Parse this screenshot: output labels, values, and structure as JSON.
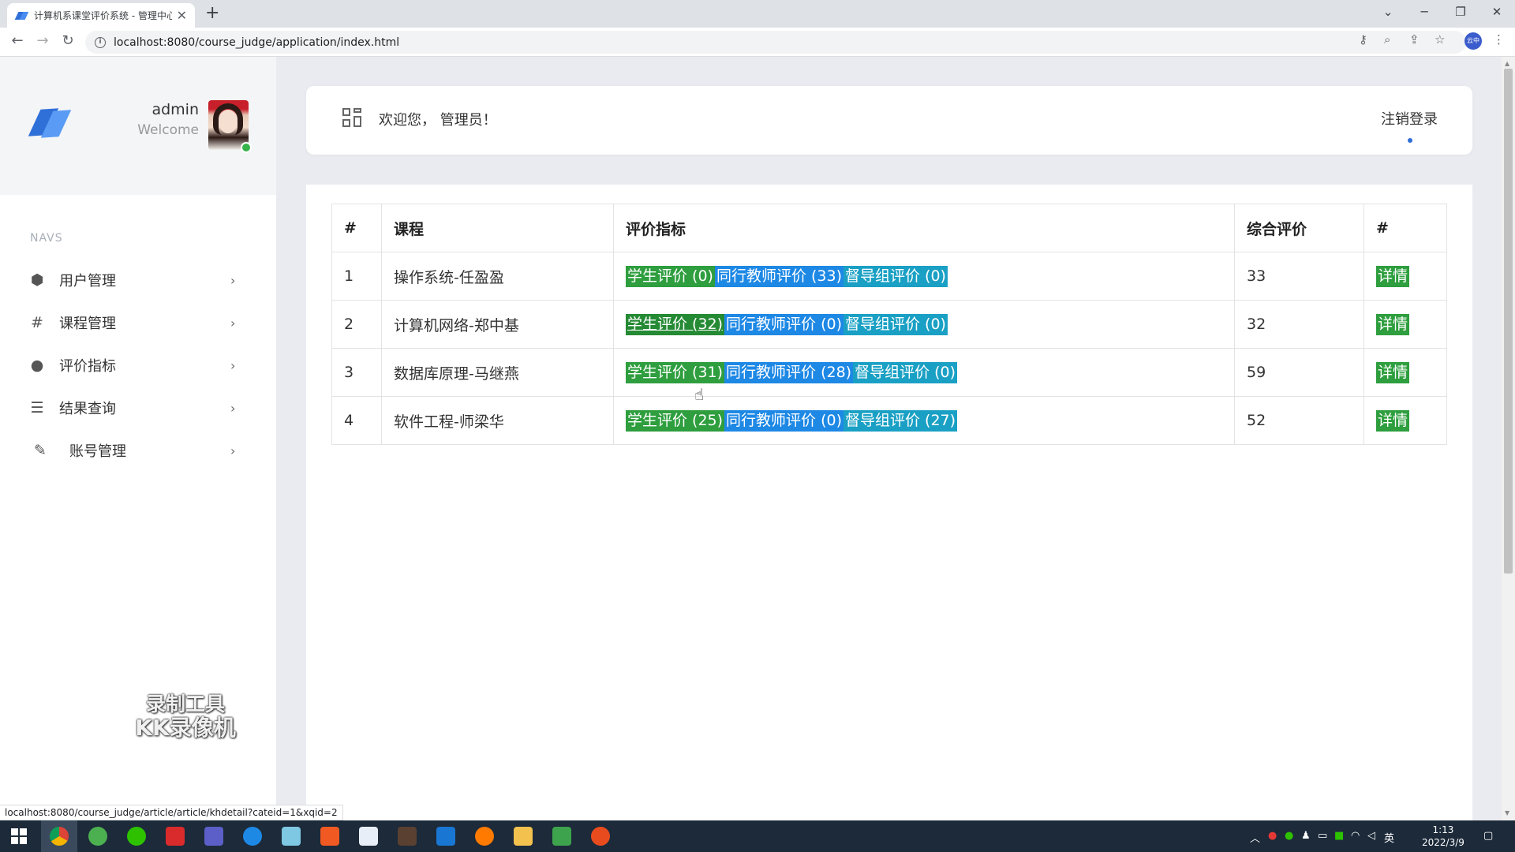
{
  "browser": {
    "tab_title": "计算机系课堂评价系统 - 管理中心",
    "tab_close": "✕",
    "new_tab": "+",
    "url": "localhost:8080/course_judge/application/index.html",
    "profile_label": "云中",
    "status_url": "localhost:8080/course_judge/article/article/khdetail?cateid=1&xqid=2"
  },
  "sidebar": {
    "username": "admin",
    "subtitle": "Welcome",
    "navs_label": "NAVS",
    "items": [
      {
        "label": "用户管理",
        "icon": "cube-icon",
        "glyph": "⬢"
      },
      {
        "label": "课程管理",
        "icon": "hash-icon",
        "glyph": "#"
      },
      {
        "label": "评价指标",
        "icon": "circle-icon",
        "glyph": "●"
      },
      {
        "label": "结果查询",
        "icon": "list-icon",
        "glyph": "☰"
      },
      {
        "label": "账号管理",
        "icon": "pencil-icon",
        "glyph": "✎"
      }
    ],
    "watermark_line1": "录制工具",
    "watermark_line2": "KK录像机"
  },
  "header": {
    "welcome": "欢迎您，  管理员！",
    "logout": "注销登录"
  },
  "table": {
    "headers": [
      "#",
      "课程",
      "评价指标",
      "综合评价",
      "#"
    ],
    "rows": [
      {
        "id": "1",
        "course": "操作系统-任盈盈",
        "student": "学生评价  (0)",
        "peer": "同行教师评价  (33)",
        "supervisor": "督导组评价  (0)",
        "score": "33",
        "action": "详情"
      },
      {
        "id": "2",
        "course": "计算机网络-郑中基",
        "student": "学生评价  (32)",
        "peer": "同行教师评价  (0)",
        "supervisor": "督导组评价  (0)",
        "score": "32",
        "action": "详情"
      },
      {
        "id": "3",
        "course": "数据库原理-马继燕",
        "student": "学生评价  (31)",
        "peer": "同行教师评价  (28)",
        "supervisor": "督导组评价  (0)",
        "score": "59",
        "action": "详情"
      },
      {
        "id": "4",
        "course": "软件工程-师梁华",
        "student": "学生评价  (25)",
        "peer": "同行教师评价  (0)",
        "supervisor": "督导组评价  (27)",
        "score": "52",
        "action": "详情"
      }
    ]
  },
  "taskbar": {
    "time": "1:13",
    "date": "2022/3/9",
    "ime": "英"
  },
  "colors": {
    "student_segment": "#2e9e3e",
    "peer_segment": "#1e88e5",
    "supervisor_segment": "#1aa0c4",
    "accent": "#2f6fd8"
  }
}
